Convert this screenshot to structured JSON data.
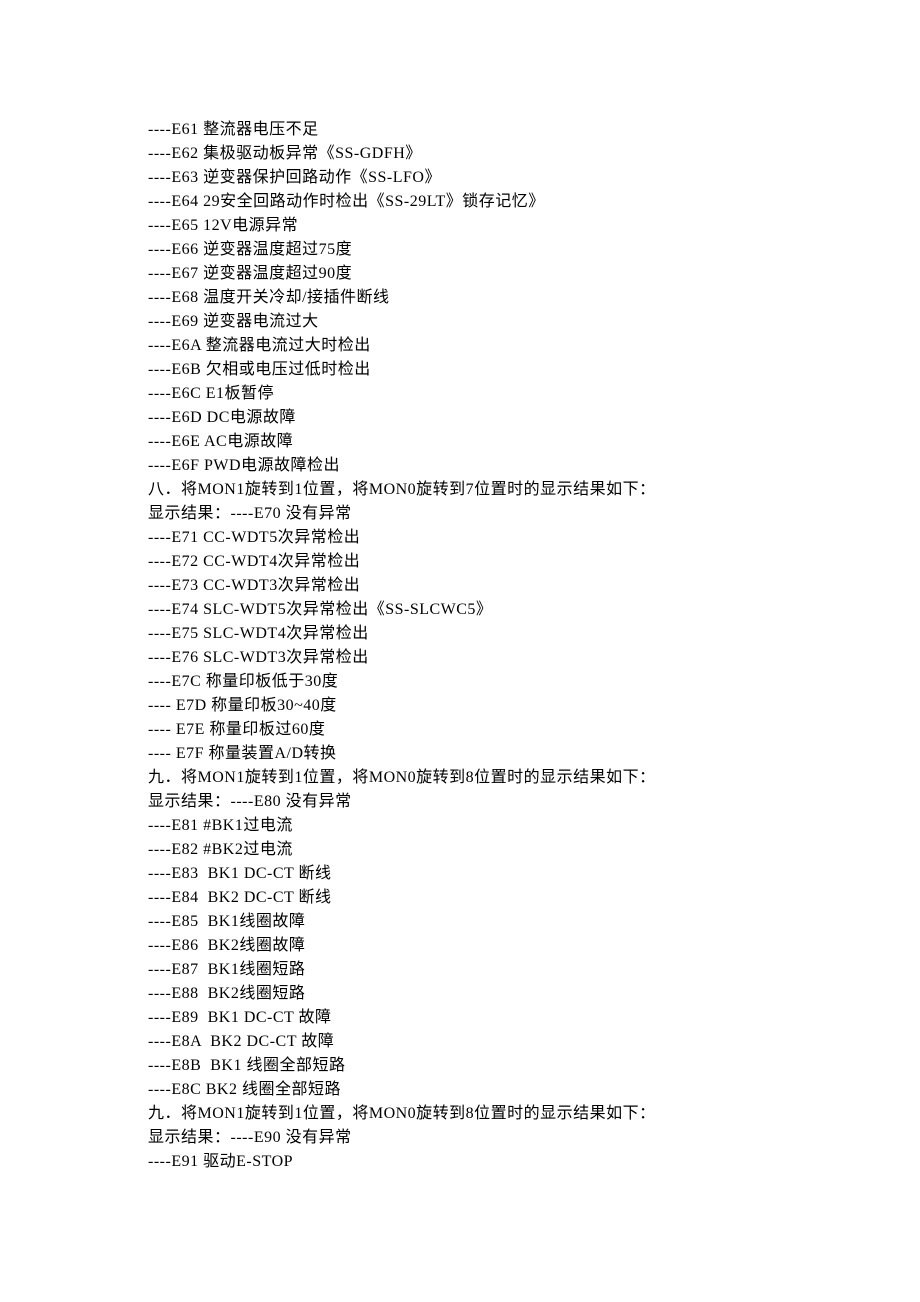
{
  "lines": [
    "----E61 整流器电压不足",
    "----E62 集极驱动板异常《SS-GDFH》",
    "----E63 逆变器保护回路动作《SS-LFO》",
    "----E64 29安全回路动作时检出《SS-29LT》锁存记忆》",
    "----E65 12V电源异常",
    "----E66 逆变器温度超过75度",
    "----E67 逆变器温度超过90度",
    "----E68 温度开关冷却/接插件断线",
    "----E69 逆变器电流过大",
    "----E6A 整流器电流过大时检出",
    "----E6B 欠相或电压过低时检出",
    "----E6C E1板暂停",
    "----E6D DC电源故障",
    "----E6E AC电源故障",
    "----E6F PWD电源故障检出",
    "八．将MON1旋转到1位置，将MON0旋转到7位置时的显示结果如下：",
    "显示结果：----E70 没有异常",
    "----E71 CC-WDT5次异常检出",
    "----E72 CC-WDT4次异常检出",
    "----E73 CC-WDT3次异常检出",
    "----E74 SLC-WDT5次异常检出《SS-SLCWC5》",
    "----E75 SLC-WDT4次异常检出",
    "----E76 SLC-WDT3次异常检出",
    "----E7C 称量印板低于30度",
    "---- E7D 称量印板30~40度",
    "---- E7E 称量印板过60度",
    "---- E7F 称量装置A/D转换",
    "九．将MON1旋转到1位置，将MON0旋转到8位置时的显示结果如下：",
    "显示结果：----E80 没有异常",
    "----E81 #BK1过电流",
    "----E82 #BK2过电流",
    "----E83  BK1 DC-CT 断线",
    "----E84  BK2 DC-CT 断线",
    "----E85  BK1线圈故障",
    "----E86  BK2线圈故障",
    "----E87  BK1线圈短路",
    "----E88  BK2线圈短路",
    "----E89  BK1 DC-CT 故障",
    "----E8A  BK2 DC-CT 故障",
    "----E8B  BK1 线圈全部短路",
    "----E8C BK2 线圈全部短路",
    "九．将MON1旋转到1位置，将MON0旋转到8位置时的显示结果如下：",
    "显示结果：----E90 没有异常",
    "----E91 驱动E-STOP"
  ]
}
